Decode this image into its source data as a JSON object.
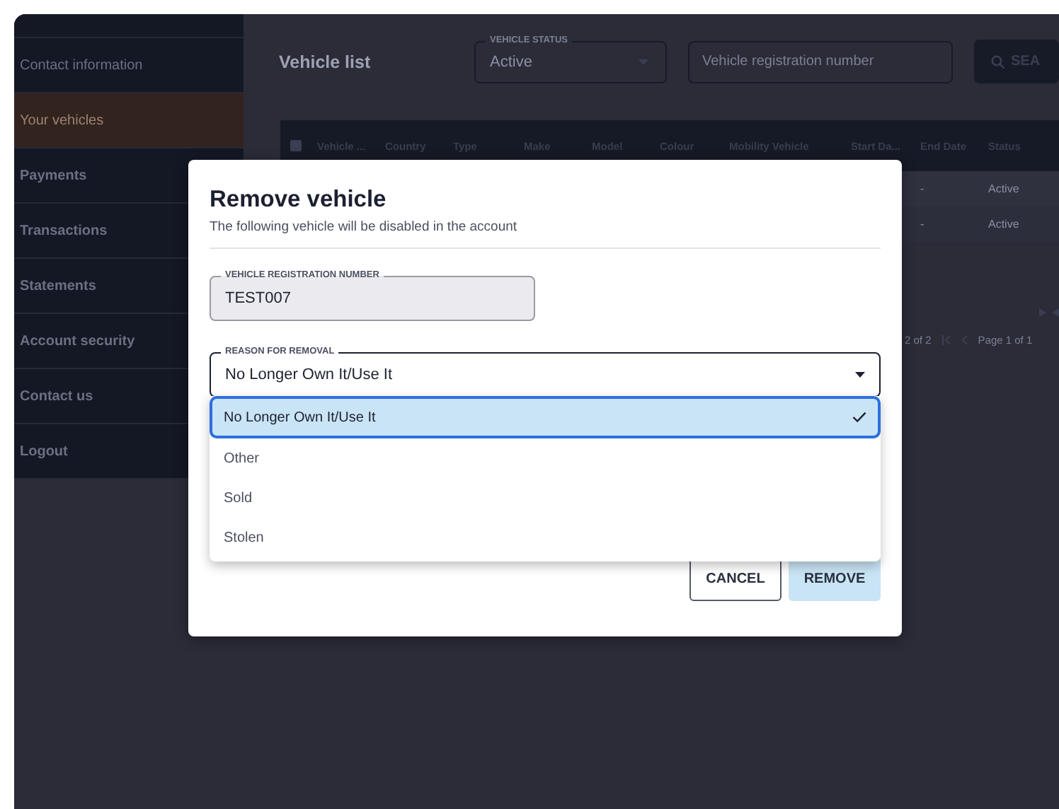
{
  "sidebar": {
    "items": [
      {
        "label": "Contact information",
        "kind": "subitem",
        "selected": false
      },
      {
        "label": "Your vehicles",
        "kind": "subitem",
        "selected": true
      },
      {
        "label": "Payments",
        "kind": "item",
        "selected": false
      },
      {
        "label": "Transactions",
        "kind": "item",
        "selected": false
      },
      {
        "label": "Statements",
        "kind": "item",
        "selected": false
      },
      {
        "label": "Account security",
        "kind": "item",
        "selected": false
      },
      {
        "label": "Contact us",
        "kind": "item",
        "selected": false
      },
      {
        "label": "Logout",
        "kind": "item",
        "selected": false
      }
    ]
  },
  "page": {
    "title": "Vehicle list",
    "status_filter": {
      "label": "VEHICLE STATUS",
      "value": "Active"
    },
    "search_field": {
      "placeholder": "Vehicle registration number"
    },
    "search_button": "SEA"
  },
  "table": {
    "select_all_checked": false,
    "columns": [
      "Vehicle ...",
      "Country",
      "Type",
      "Make",
      "Model",
      "Colour",
      "Mobility Vehicle",
      "Start Da...",
      "End Date",
      "Status"
    ],
    "rows": [
      {
        "end_date": "-",
        "status": "Active"
      },
      {
        "end_date": "-",
        "status": "Active"
      }
    ]
  },
  "pagination": {
    "range": "2 of 2",
    "page": "Page 1 of 1"
  },
  "dialog": {
    "title": "Remove vehicle",
    "subtitle": "The following vehicle will be disabled in the account",
    "registration_field": {
      "label": "VEHICLE REGISTRATION NUMBER",
      "value": "TEST007",
      "disabled": true
    },
    "reason_field": {
      "label": "REASON FOR REMOVAL",
      "value": "No Longer Own It/Use It",
      "expanded": true,
      "options": [
        {
          "label": "No Longer Own It/Use It",
          "selected": true
        },
        {
          "label": "Other",
          "selected": false
        },
        {
          "label": "Sold",
          "selected": false
        },
        {
          "label": "Stolen",
          "selected": false
        }
      ]
    },
    "buttons": [
      {
        "label": "CANCEL",
        "kind": "secondary"
      },
      {
        "label": "REMOVE",
        "kind": "primary"
      }
    ]
  }
}
